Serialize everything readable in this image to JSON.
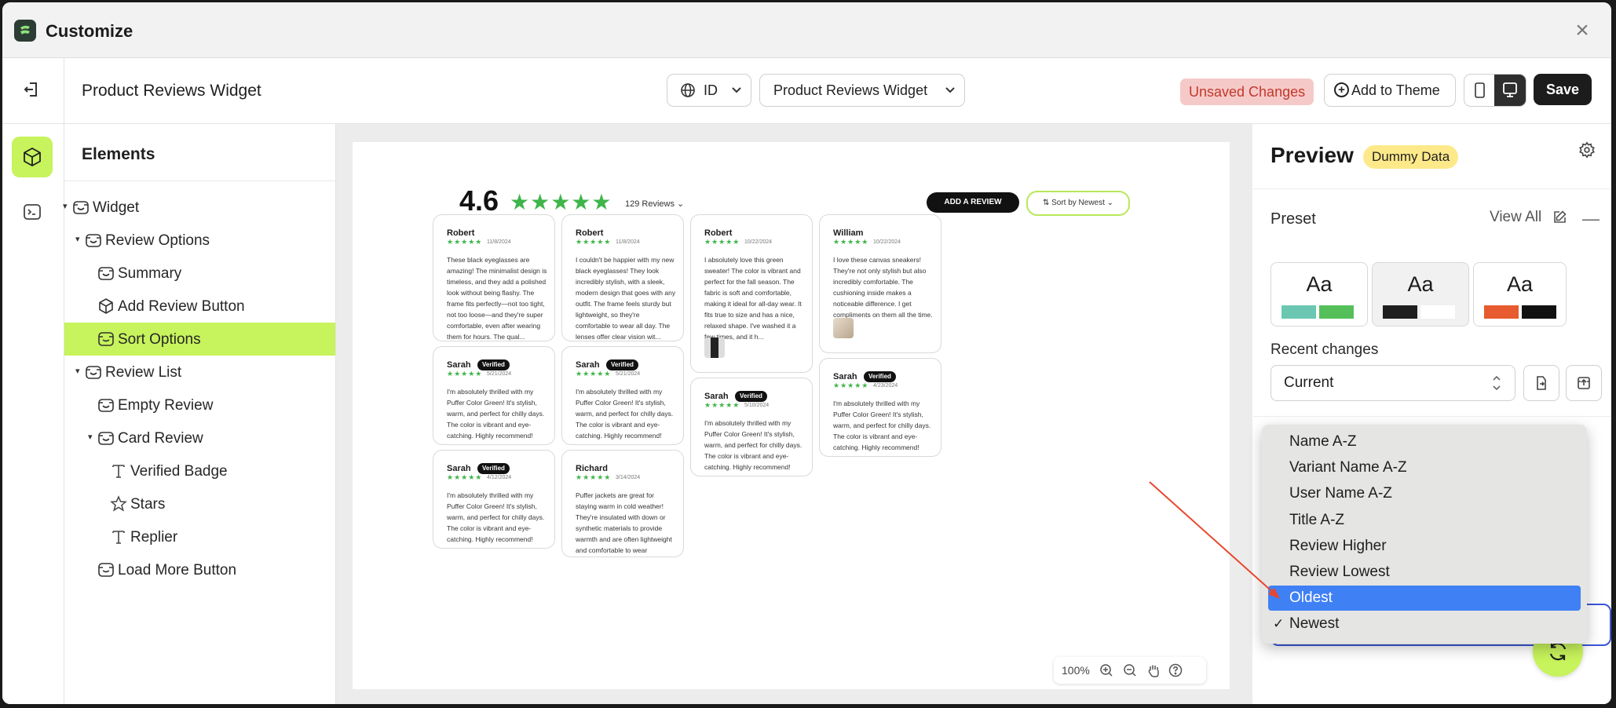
{
  "window": {
    "title": "Customize",
    "close_glyph": "×"
  },
  "toolbar": {
    "page_title": "Product Reviews Widget",
    "language": "ID",
    "widget_select": "Product Reviews Widget",
    "unsaved": "Unsaved Changes",
    "add_to_theme": "Add to Theme",
    "save": "Save"
  },
  "elements_panel": {
    "title": "Elements",
    "items": [
      {
        "label": "Widget",
        "icon": "widget-icon"
      },
      {
        "label": "Review Options",
        "icon": "widget-icon"
      },
      {
        "label": "Summary",
        "icon": "widget-icon"
      },
      {
        "label": "Add Review Button",
        "icon": "cube-icon"
      },
      {
        "label": "Sort Options",
        "icon": "container-icon",
        "selected": true
      },
      {
        "label": "Review List",
        "icon": "widget-icon"
      },
      {
        "label": "Empty Review",
        "icon": "widget-icon"
      },
      {
        "label": "Card Review",
        "icon": "widget-icon"
      },
      {
        "label": "Verified Badge",
        "icon": "text-icon"
      },
      {
        "label": "Stars",
        "icon": "star-icon"
      },
      {
        "label": "Replier",
        "icon": "text-icon"
      },
      {
        "label": "Load More Button",
        "icon": "container-icon"
      }
    ]
  },
  "canvas": {
    "rating": "4.6",
    "stars": "★★★★★",
    "reviews_count": "129 Reviews ⌄",
    "add_review": "ADD A REVIEW",
    "sort_label": "⇅  Sort by Newest  ⌄",
    "reviews": [
      {
        "name": "Robert",
        "verified": false,
        "stars": "★★★★★",
        "date": "11/8/2024",
        "text": "These black eyeglasses are amazing! The minimalist design is timeless, and they add a polished look without being flashy. The frame fits perfectly—not too tight, not too loose—and they're super comfortable, even after wearing them for hours. The qual..."
      },
      {
        "name": "Robert",
        "verified": false,
        "stars": "★★★★★",
        "date": "11/8/2024",
        "text": "I couldn't be happier with my new black eyeglasses! They look incredibly stylish, with a sleek, modern design that goes with any outfit. The frame feels sturdy but lightweight, so they're comfortable to wear all day. The lenses offer clear vision wit..."
      },
      {
        "name": "Robert",
        "verified": false,
        "stars": "★★★★★",
        "date": "10/22/2024",
        "text": "I absolutely love this green sweater! The color is vibrant and perfect for the fall season. The fabric is soft and comfortable, making it ideal for all-day wear. It fits true to size and has a nice, relaxed shape. I've washed it a few times, and it h..."
      },
      {
        "name": "William",
        "verified": false,
        "stars": "★★★★★",
        "date": "10/22/2024",
        "text": "I love these canvas sneakers! They're not only stylish but also incredibly comfortable. The cushioning inside makes a noticeable difference. I get compliments on them all the time."
      },
      {
        "name": "Sarah",
        "verified": true,
        "stars": "★★★★★",
        "date": "5/21/2024",
        "text": "I'm absolutely thrilled with my Puffer Color Green! It's stylish, warm, and perfect for chilly days. The color is vibrant and eye-catching. Highly recommend!"
      },
      {
        "name": "Sarah",
        "verified": true,
        "stars": "★★★★★",
        "date": "5/21/2024",
        "text": "I'm absolutely thrilled with my Puffer Color Green! It's stylish, warm, and perfect for chilly days. The color is vibrant and eye-catching. Highly recommend!"
      },
      {
        "name": "Sarah",
        "verified": true,
        "stars": "★★★★★",
        "date": "5/10/2024",
        "text": "I'm absolutely thrilled with my Puffer Color Green! It's stylish, warm, and perfect for chilly days. The color is vibrant and eye-catching. Highly recommend!"
      },
      {
        "name": "Sarah",
        "verified": true,
        "stars": "★★★★★",
        "date": "4/23/2024",
        "text": "I'm absolutely thrilled with my Puffer Color Green! It's stylish, warm, and perfect for chilly days. The color is vibrant and eye-catching. Highly recommend!"
      },
      {
        "name": "Sarah",
        "verified": true,
        "stars": "★★★★★",
        "date": "4/12/2024",
        "text": "I'm absolutely thrilled with my Puffer Color Green! It's stylish, warm, and perfect for chilly days. The color is vibrant and eye-catching. Highly recommend!"
      },
      {
        "name": "Richard",
        "verified": false,
        "stars": "★★★★★",
        "date": "3/14/2024",
        "text": "Puffer jackets are great for staying warm in cold weather! They're insulated with down or synthetic materials to provide warmth and are often lightweight and comfortable to wear"
      }
    ],
    "verified_label": "Verified",
    "zoom": "100%"
  },
  "right_panel": {
    "title": "Preview",
    "badge": "Dummy Data",
    "preset_title": "Preset",
    "view_all": "View All",
    "collapse_glyph": "—",
    "preset_aa": "Aa",
    "presets": [
      {
        "colors": [
          "#6cc7b2",
          "#55c05a"
        ]
      },
      {
        "colors": [
          "#1e1e1e",
          "#ffffff"
        ]
      },
      {
        "colors": [
          "#e85a2f",
          "#111111"
        ]
      }
    ],
    "recent_title": "Recent changes",
    "recent_value": "Current",
    "updown_glyph": "⌃⌄"
  },
  "sort_menu": {
    "items": [
      "Name A-Z",
      "Variant Name A-Z",
      "User Name A-Z",
      "Title A-Z",
      "Review Higher",
      "Review Lowest",
      "Oldest",
      "Newest"
    ],
    "highlighted": "Oldest",
    "checked": "Newest",
    "check_glyph": "✓"
  },
  "colors": {
    "accent": "#c7f35c",
    "highlight": "#3f80f5",
    "star": "#3fb54a",
    "unsaved_bg": "#f6c9c9",
    "annotation_arrow": "#e8472f"
  }
}
